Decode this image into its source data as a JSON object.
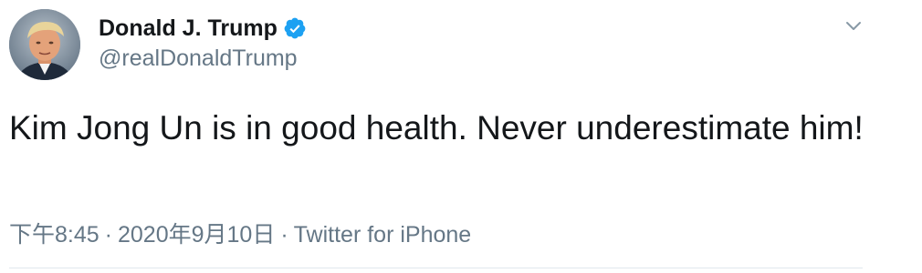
{
  "tweet": {
    "author": {
      "display_name": "Donald J. Trump",
      "handle": "@realDonaldTrump",
      "verified": true,
      "avatar_icon": "profile-photo"
    },
    "text": "Kim Jong Un is in good health. Never underestimate him!",
    "time": "下午8:45",
    "date": "2020年9月10日",
    "separator": "·",
    "source": "Twitter for iPhone",
    "menu_icon": "chevron-down-icon"
  },
  "colors": {
    "primary_text": "#14171a",
    "secondary_text": "#657786",
    "verified_blue": "#1da1f2",
    "divider": "#e1e8ed"
  }
}
